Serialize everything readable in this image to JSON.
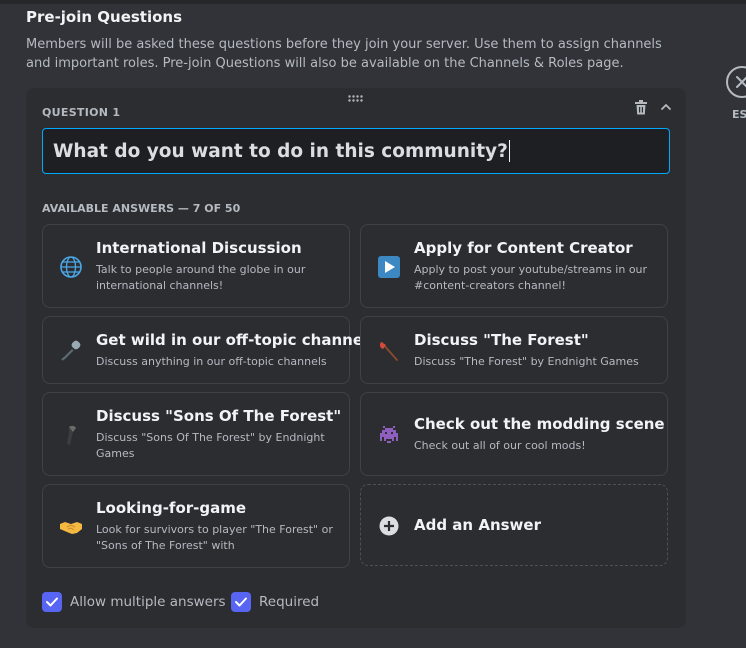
{
  "section": {
    "title": "Pre-join Questions",
    "description": "Members will be asked these questions before they join your server. Use them to assign channels and important roles. Pre-join Questions will also be available on the Channels & Roles page."
  },
  "close": {
    "esc_label": "ES",
    "icon": "close-icon"
  },
  "question": {
    "label": "QUESTION 1",
    "value": "What do you want to do in this community?",
    "icons": [
      "drag-handle-icon",
      "trash-icon",
      "chevron-up-icon"
    ]
  },
  "answers_header": "AVAILABLE ANSWERS — 7 OF 50",
  "answers": [
    {
      "title": "International Discussion",
      "description": "Talk to people around the globe in our international channels!",
      "emoji": "globe-icon"
    },
    {
      "title": "Apply for Content Creator",
      "description": "Apply to post your youtube/streams in our #content-creators channel!",
      "emoji": "play-button-icon"
    },
    {
      "title": "Get wild in our off-topic channels",
      "description": "Discuss anything in our off-topic channels",
      "emoji": "microphone-icon"
    },
    {
      "title": "Discuss \"The Forest\"",
      "description": "Discuss \"The Forest\" by Endnight Games",
      "emoji": "axe-icon"
    },
    {
      "title": "Discuss \"Sons Of The Forest\"",
      "description": "Discuss \"Sons Of The Forest\" by Endnight Games",
      "emoji": "club-icon"
    },
    {
      "title": "Check out the modding scene",
      "description": "Check out all of our cool mods!",
      "emoji": "space-invader-icon"
    },
    {
      "title": "Looking-for-game",
      "description": "Look for survivors to player \"The Forest\" or \"Sons of The Forest\" with",
      "emoji": "handshake-icon"
    }
  ],
  "add_answer": {
    "label": "Add an Answer",
    "icon": "plus-circle-icon"
  },
  "options": {
    "allow_multiple": {
      "label": "Allow multiple answers",
      "checked": true
    },
    "required": {
      "label": "Required",
      "checked": true
    }
  },
  "colors": {
    "accent": "#5865f2",
    "focus_border": "#00a8fc",
    "card_bg": "#2b2d31",
    "page_bg": "#313338"
  }
}
